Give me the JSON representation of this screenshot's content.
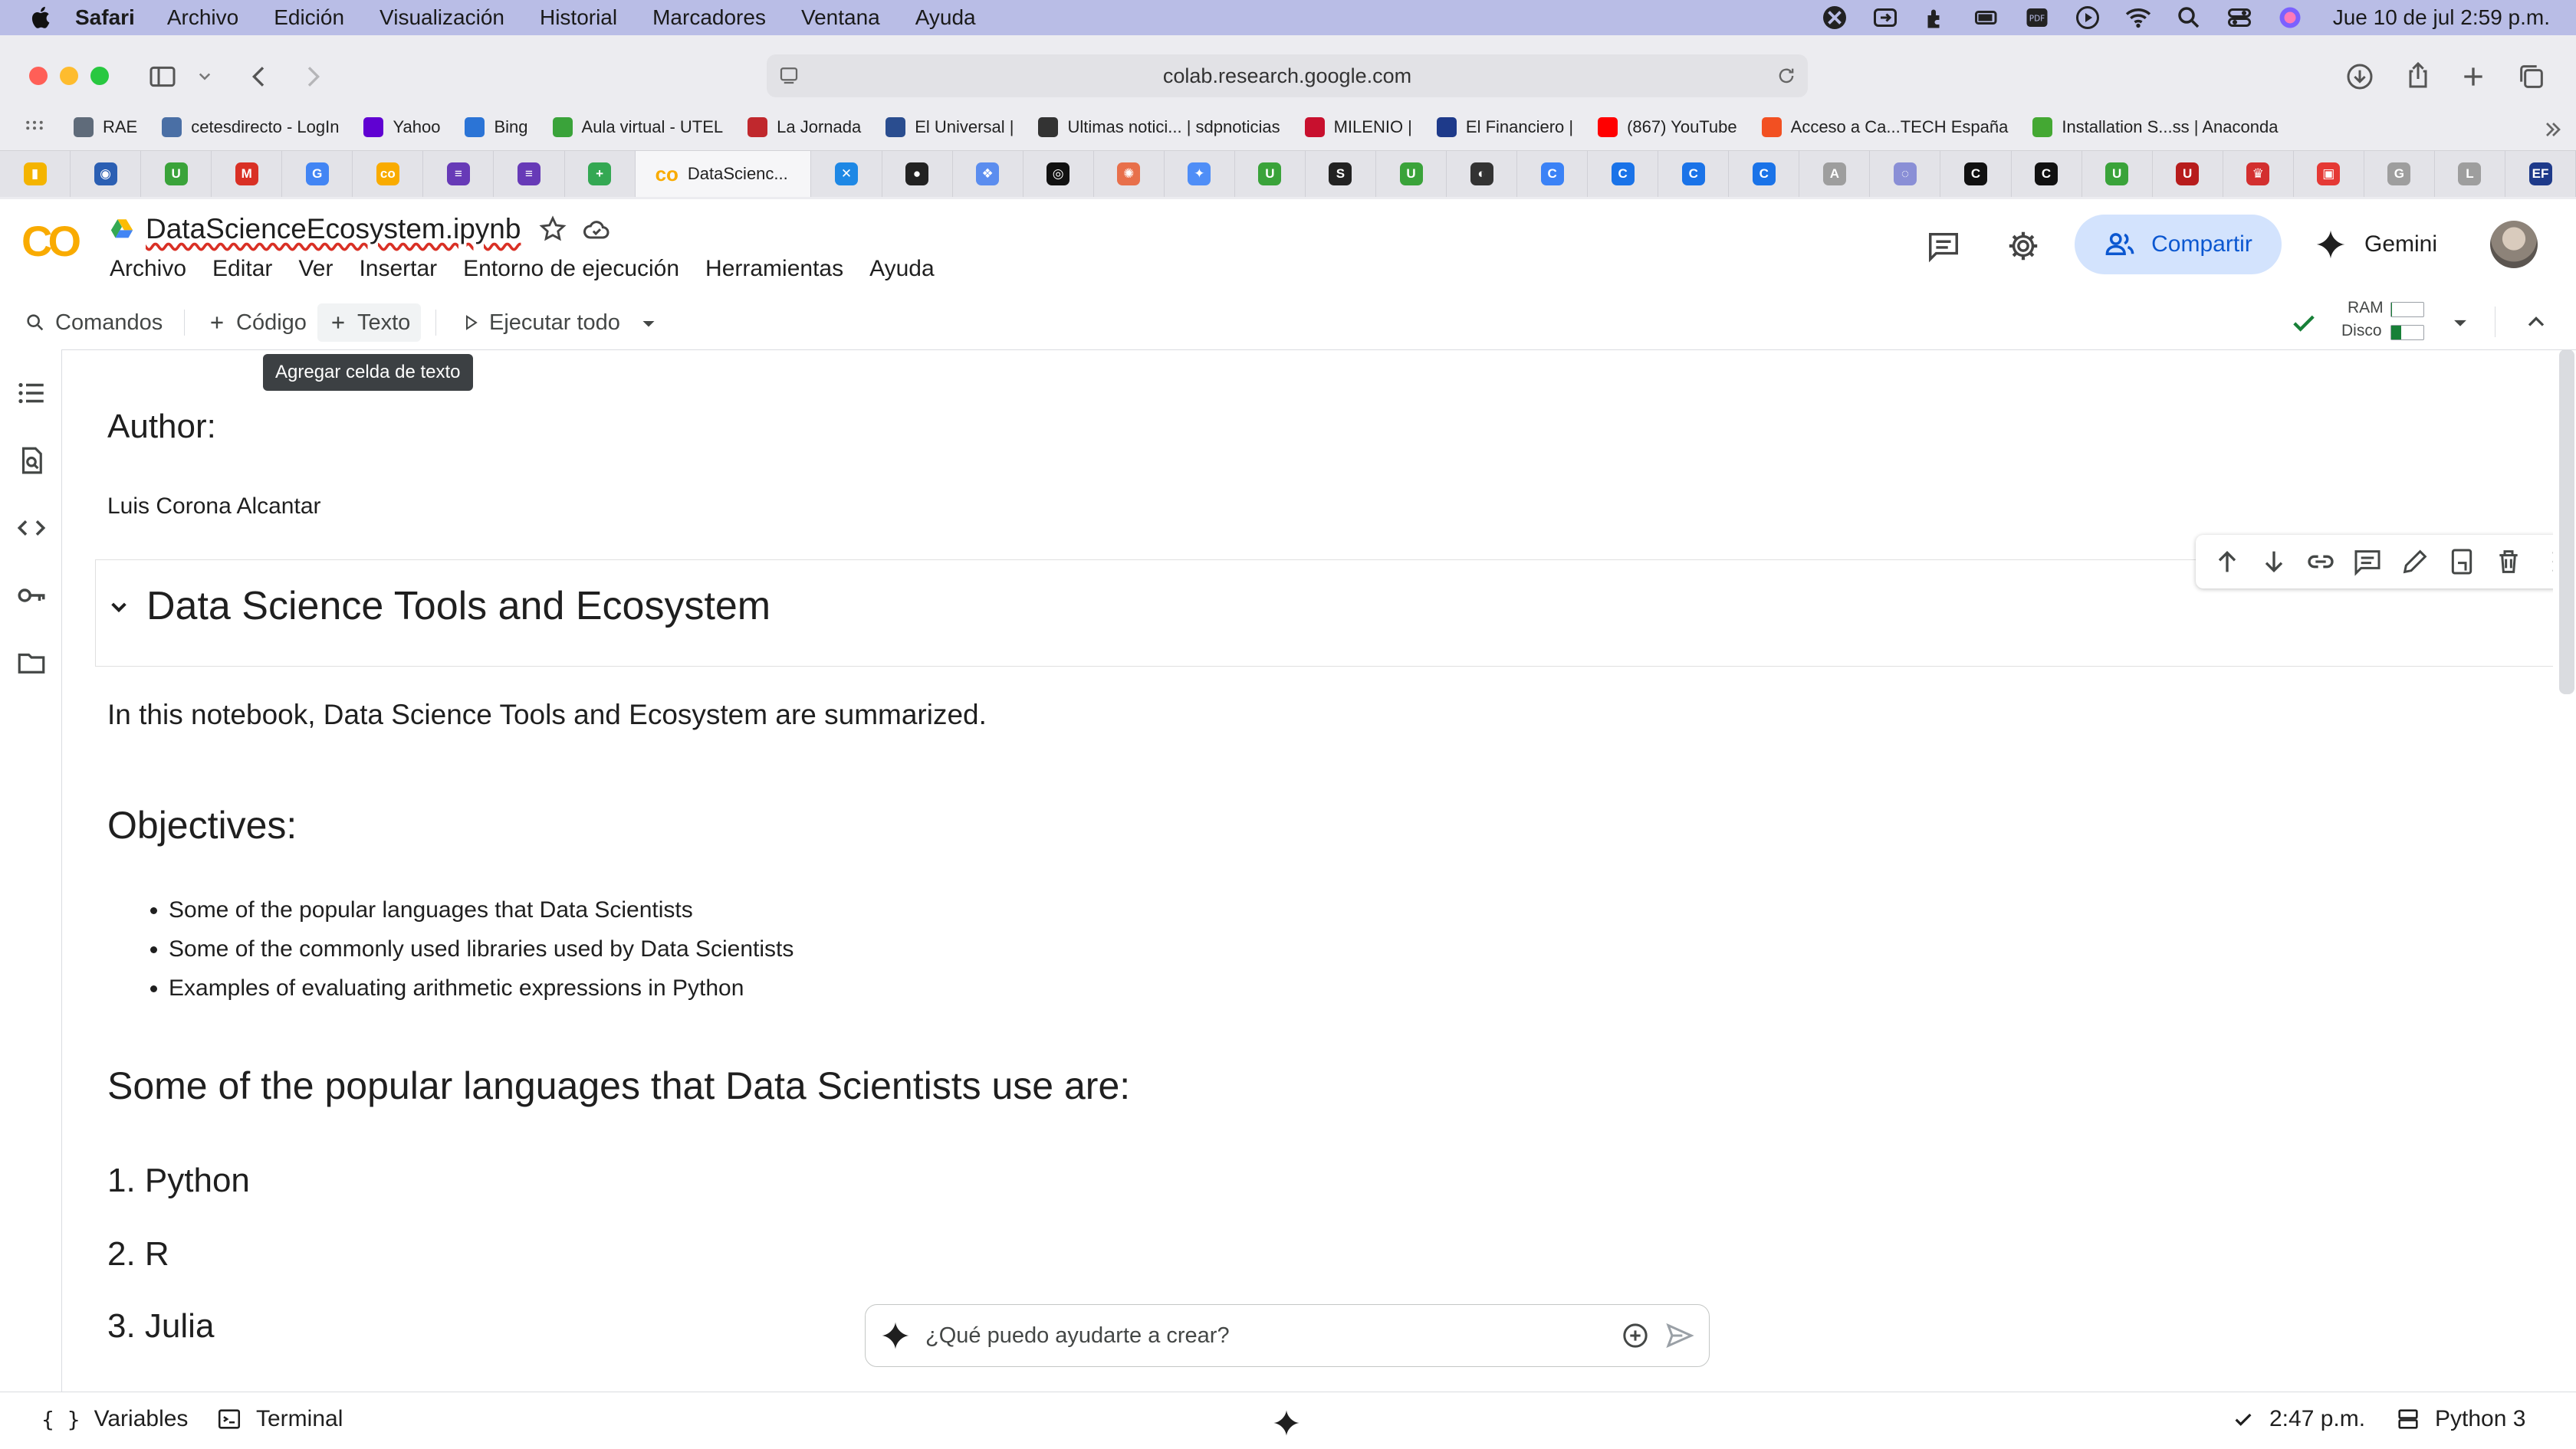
{
  "menubar": {
    "app": "Safari",
    "items": [
      "Archivo",
      "Edición",
      "Visualización",
      "Historial",
      "Marcadores",
      "Ventana",
      "Ayuda"
    ],
    "status_icons": [
      "accessibility-icon",
      "sync-icon",
      "puzzle-icon",
      "battery-icon",
      "pdf-icon",
      "play-icon",
      "wifi-icon",
      "search-icon",
      "control-center-icon",
      "siri-icon"
    ],
    "clock": "Jue 10 de jul  2:59 p.m."
  },
  "safari": {
    "url": "colab.research.google.com",
    "bookmarks": [
      {
        "label": "RAE",
        "color": "#5f6b7a"
      },
      {
        "label": "cetesdirecto - LogIn",
        "color": "#4a6fa5"
      },
      {
        "label": "Yahoo",
        "color": "#6001d2"
      },
      {
        "label": "Bing",
        "color": "#2b74d6"
      },
      {
        "label": "Aula virtual - UTEL",
        "color": "#3aa33a"
      },
      {
        "label": "La Jornada",
        "color": "#c0282d"
      },
      {
        "label": "El Universal |",
        "color": "#2a4d8f"
      },
      {
        "label": "Ultimas notici... | sdpnoticias",
        "color": "#333333"
      },
      {
        "label": "MILENIO |",
        "color": "#c8102e"
      },
      {
        "label": "El Financiero |",
        "color": "#1e3a8a"
      },
      {
        "label": "(867) YouTube",
        "color": "#ff0000"
      },
      {
        "label": "Acceso a Ca...TECH España",
        "color": "#f25022"
      },
      {
        "label": "Installation S...ss | Anaconda",
        "color": "#44a833"
      }
    ],
    "tabs": [
      {
        "glyph": "▮",
        "color": "#f4b400"
      },
      {
        "glyph": "◉",
        "color": "#2b5fb3"
      },
      {
        "glyph": "U",
        "color": "#3aa33a"
      },
      {
        "glyph": "M",
        "color": "#d93025"
      },
      {
        "glyph": "G",
        "color": "#4285f4"
      },
      {
        "glyph": "co",
        "color": "#f9ab00"
      },
      {
        "glyph": "≡",
        "color": "#673ab7"
      },
      {
        "glyph": "≡",
        "color": "#673ab7"
      },
      {
        "glyph": "+",
        "color": "#34a853"
      },
      {
        "glyph": "active",
        "color": "#f9ab00"
      },
      {
        "glyph": "✕",
        "color": "#1e88e5"
      },
      {
        "glyph": "●",
        "color": "#222222"
      },
      {
        "glyph": "❖",
        "color": "#5b8def"
      },
      {
        "glyph": "◎",
        "color": "#111111"
      },
      {
        "glyph": "✺",
        "color": "#e8704b"
      },
      {
        "glyph": "✦",
        "color": "#4f8ef7"
      },
      {
        "glyph": "U",
        "color": "#3aa33a"
      },
      {
        "glyph": "S",
        "color": "#222222"
      },
      {
        "glyph": "U",
        "color": "#3aa33a"
      },
      {
        "glyph": "◐",
        "color": "#333333"
      },
      {
        "glyph": "C",
        "color": "#3b82f6"
      },
      {
        "glyph": "C",
        "color": "#1a73e8"
      },
      {
        "glyph": "C",
        "color": "#1a73e8"
      },
      {
        "glyph": "C",
        "color": "#1a73e8"
      },
      {
        "glyph": "A",
        "color": "#9e9e9e"
      },
      {
        "glyph": "◌",
        "color": "#8a8fd6"
      },
      {
        "glyph": "C",
        "color": "#111111"
      },
      {
        "glyph": "C",
        "color": "#111111"
      },
      {
        "glyph": "U",
        "color": "#3aa33a"
      },
      {
        "glyph": "U",
        "color": "#b71c1c"
      },
      {
        "glyph": "♛",
        "color": "#d32f2f"
      },
      {
        "glyph": "▣",
        "color": "#e53935"
      },
      {
        "glyph": "G",
        "color": "#9e9e9e"
      },
      {
        "glyph": "L",
        "color": "#9e9e9e"
      },
      {
        "glyph": "EF",
        "color": "#1e3a8a"
      }
    ],
    "active_tab_label": "DataScienc..."
  },
  "colab": {
    "title": "DataScienceEcosystem.ipynb",
    "menus": [
      "Archivo",
      "Editar",
      "Ver",
      "Insertar",
      "Entorno de ejecución",
      "Herramientas",
      "Ayuda"
    ],
    "share_label": "Compartir",
    "gemini_label": "Gemini",
    "toolbar": {
      "commands": "Comandos",
      "code": "Código",
      "text": "Texto",
      "run_all": "Ejecutar todo",
      "ram": "RAM",
      "disk": "Disco"
    },
    "tooltip": "Agregar celda de texto",
    "colors": {
      "accent": "#0b57d0",
      "share_bg": "#d3e3fd",
      "logo": "#f9ab00",
      "ok": "#188038"
    }
  },
  "notebook": {
    "author_heading": "Author:",
    "author_name": "Luis Corona Alcantar",
    "section_title": "Data Science Tools and Ecosystem",
    "intro": "In this notebook, Data Science Tools and Ecosystem are summarized.",
    "objectives_heading": "Objectives:",
    "objectives": [
      "Some of the popular languages that Data Scientists",
      "Some of the commonly used libraries used by Data Scientists",
      "Examples of evaluating arithmetic expressions in Python"
    ],
    "languages_heading": "Some of the popular languages that Data Scientists use are:",
    "languages": [
      "1. Python",
      "2. R",
      "3. Julia"
    ]
  },
  "gemini_input": {
    "placeholder": "¿Qué puedo ayudarte a crear?"
  },
  "statusbar": {
    "variables": "Variables",
    "terminal": "Terminal",
    "time": "2:47 p.m.",
    "runtime": "Python 3"
  }
}
